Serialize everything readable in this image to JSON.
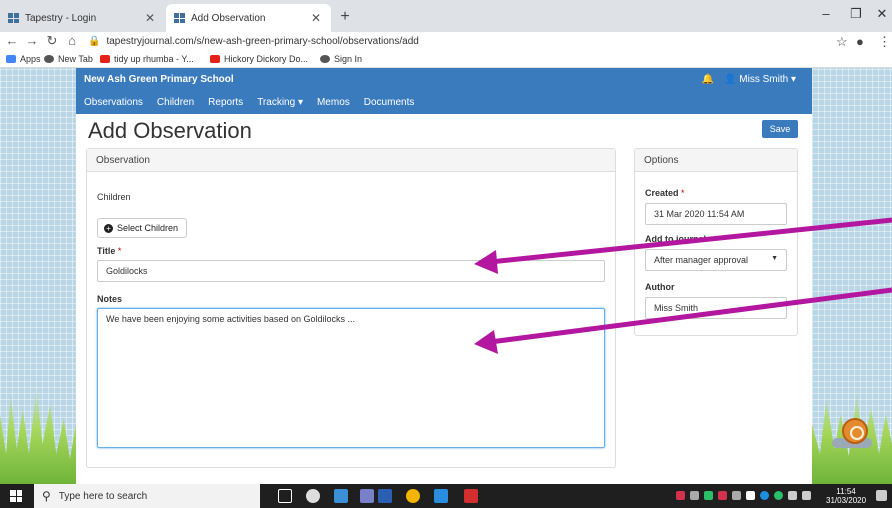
{
  "browser": {
    "tabs": [
      {
        "title": "Tapestry - Login",
        "active": false
      },
      {
        "title": "Add Observation",
        "active": true
      }
    ],
    "new_tab_symbol": "+",
    "url": "tapestryjournal.com/s/new-ash-green-primary-school/observations/add",
    "bookmarks": [
      {
        "label": "Apps",
        "icon": "apps-icon",
        "color": "#4285f4"
      },
      {
        "label": "New Tab",
        "icon": "globe-icon",
        "color": "#555555"
      },
      {
        "label": "tidy up rhumba - Y...",
        "icon": "youtube-icon",
        "color": "#e62117"
      },
      {
        "label": "Hickory Dickory Do...",
        "icon": "youtube-icon",
        "color": "#e62117"
      },
      {
        "label": "Sign In",
        "icon": "globe-icon",
        "color": "#555555"
      }
    ]
  },
  "nav": {
    "school": "New Ash Green Primary School",
    "links": [
      "Observations",
      "Children",
      "Reports",
      "Tracking ▾",
      "Memos",
      "Documents"
    ],
    "user": "Miss Smith ▾"
  },
  "main": {
    "title": "Add Observation",
    "save_label": "Save",
    "observation": {
      "header": "Observation",
      "children_label": "Children",
      "select_children_label": "Select Children",
      "title_label": "Title",
      "title_value": "Goldilocks",
      "notes_label": "Notes",
      "notes_value": "We have been enjoying some activities based on Goldilocks ..."
    },
    "options": {
      "header": "Options",
      "created_label": "Created",
      "created_value": "31 Mar 2020 11:54 AM",
      "add_to_journal_label": "Add to journal",
      "add_to_journal_value": "After manager approval",
      "author_label": "Author",
      "author_value": "Miss Smith"
    },
    "required_mark": "*"
  },
  "taskbar": {
    "search_placeholder": "Type here to search",
    "time": "11:54",
    "date": "31/03/2020"
  },
  "colors": {
    "brand": "#3a7bbd",
    "annotation_arrow": "#b3169f"
  }
}
